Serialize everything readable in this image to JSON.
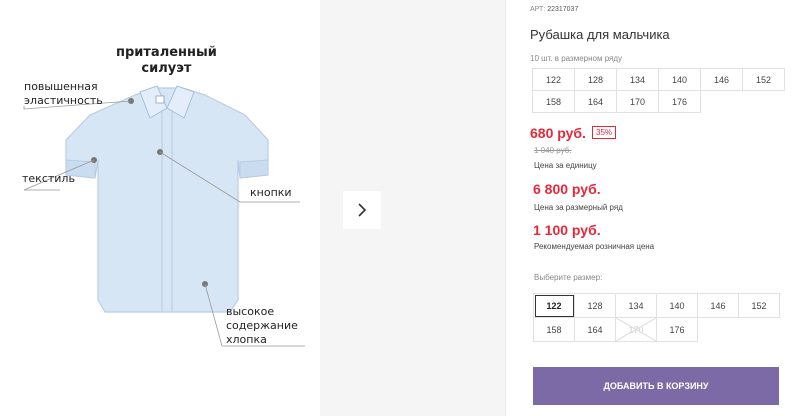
{
  "product": {
    "art_label": "АРТ:",
    "art_value": "22317037",
    "title": "Рубашка для мальчика",
    "pack_note": "10 шт. в размерном ряду"
  },
  "size_row": [
    "122",
    "128",
    "134",
    "140",
    "146",
    "152",
    "158",
    "164",
    "170",
    "176"
  ],
  "pricing": {
    "unit_price": "680 руб.",
    "discount": "35%",
    "old_price": "1 040 руб.",
    "unit_caption": "Цена за единицу",
    "pack_price": "6 800 руб.",
    "pack_caption": "Цена за размерный ряд",
    "retail_price": "1 100 руб.",
    "retail_caption": "Рекомендуемая розничная цена"
  },
  "size_select": {
    "label": "Выберите размер:",
    "options": [
      "122",
      "128",
      "134",
      "140",
      "146",
      "152",
      "158",
      "164",
      "170",
      "176"
    ],
    "selected": "122",
    "disabled": [
      "170"
    ]
  },
  "cart_button": "ДОБАВИТЬ В КОРЗИНУ",
  "image_callouts": {
    "silhouette": [
      "приталенный",
      "силуэт"
    ],
    "elasticity": [
      "повышенная",
      "эластичность"
    ],
    "fabric": "текстиль",
    "buttons": "кнопки",
    "cotton": [
      "высокое",
      "содержание",
      "хлопка"
    ]
  },
  "colors": {
    "price_red": "#e6283b",
    "cart_purple": "#7b6aa6",
    "shirt_blue": "#d7e6f5"
  },
  "icons": {
    "next_arrow": "chevron-right-icon"
  }
}
